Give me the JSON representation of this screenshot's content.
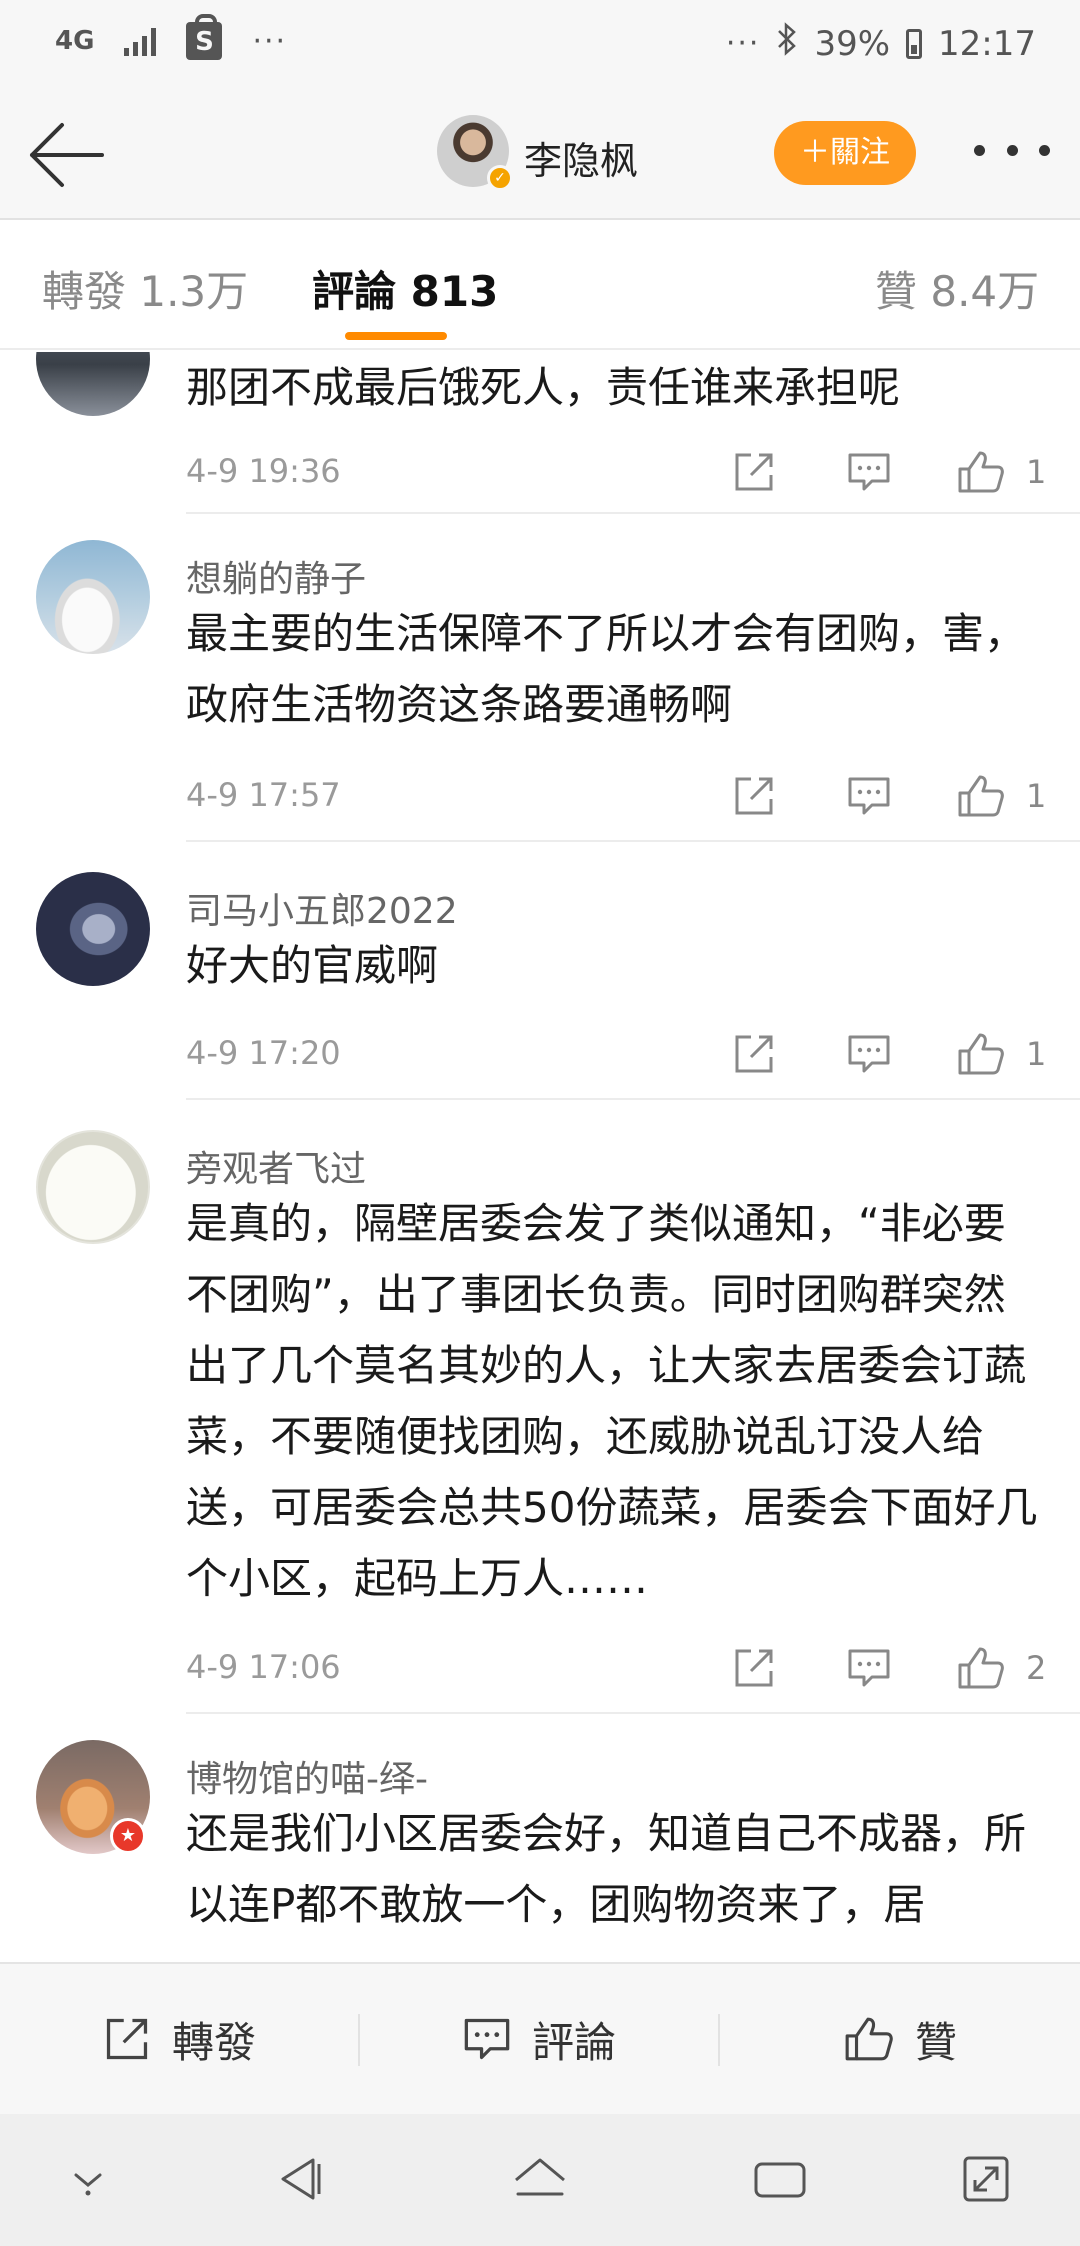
{
  "status_bar": {
    "network": "4G",
    "extra_dots": "···",
    "right_dots": "···",
    "battery": "39%",
    "time": "12:17",
    "icons": [
      "signal-icon",
      "shopping-bag-icon",
      "bluetooth-icon",
      "battery-icon"
    ]
  },
  "header": {
    "name": "李隐枫",
    "follow_label": "＋關注"
  },
  "tabs": {
    "repost": "轉發 1.3万",
    "comments": "評論 813",
    "likes": "贊 8.4万",
    "active": "comments"
  },
  "comments": [
    {
      "name": "",
      "text": "那团不成最后饿死人，责任谁来承担呢",
      "time": "4-9 19:36",
      "likes": "1"
    },
    {
      "name": "想躺的静子",
      "text": "最主要的生活保障不了所以才会有团购，害，政府生活物资这条路要通畅啊",
      "time": "4-9 17:57",
      "likes": "1"
    },
    {
      "name": "司马小五郎2022",
      "text": "好大的官威啊",
      "time": "4-9 17:20",
      "likes": "1"
    },
    {
      "name": "旁观者飞过",
      "text": "是真的，隔壁居委会发了类似通知，“非必要不团购”，出了事团长负责。同时团购群突然出了几个莫名其妙的人，让大家去居委会订蔬菜，不要随便找团购，还威胁说乱订没人给送，可居委会总共50份蔬菜，居委会下面好几个小区，起码上万人……",
      "time": "4-9 17:06",
      "likes": "2"
    },
    {
      "name": "博物馆的喵-绎-",
      "text": "还是我们小区居委会好，知道自己不成器，所以连P都不敢放一个，团购物资来了，居",
      "time": "",
      "likes": ""
    }
  ],
  "bottom_bar": {
    "repost": "轉發",
    "comment": "評論",
    "like": "贊"
  },
  "colors": {
    "accent": "#ff8a00",
    "follow_button": "#ff9a1f",
    "verified_badge": "#f5a300",
    "username": "#666666",
    "timestamp": "#9a9a9a"
  }
}
